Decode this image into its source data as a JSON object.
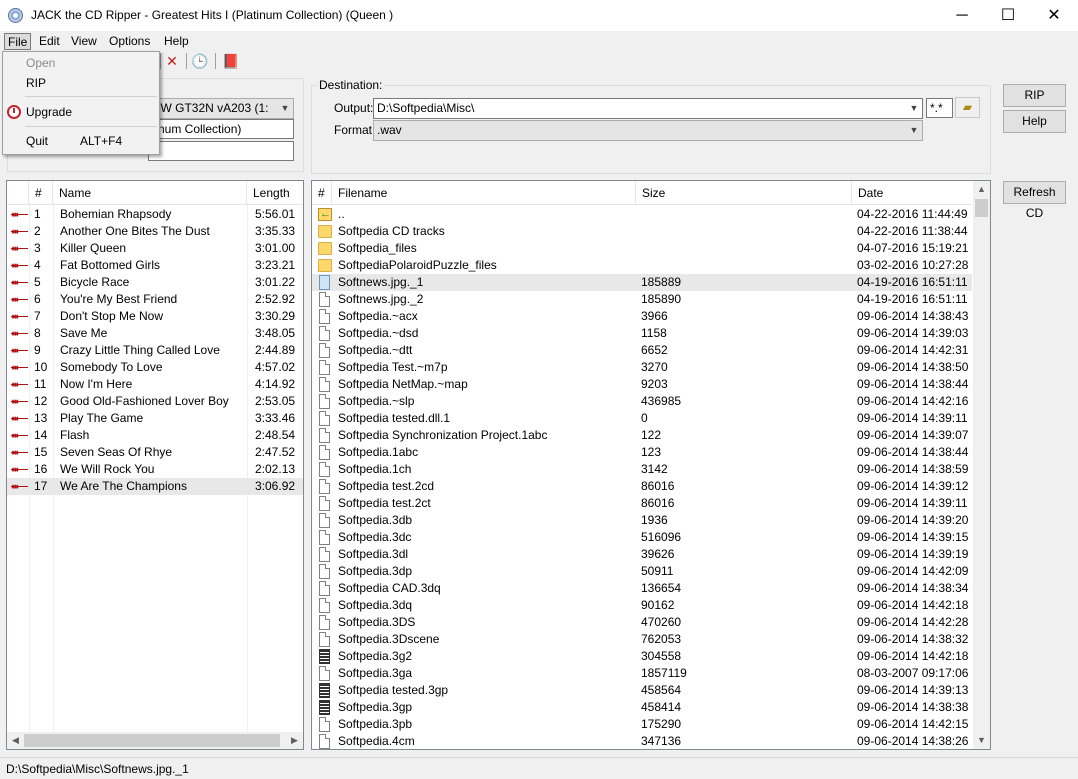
{
  "window": {
    "title": "JACK the CD Ripper - Greatest Hits I (Platinum  Collection) (Queen )",
    "minimize": "─",
    "maximize": "☐",
    "close": "✕"
  },
  "menubar": {
    "items": [
      {
        "label": "File",
        "underline": "F"
      },
      {
        "label": "Edit",
        "underline": "E"
      },
      {
        "label": "View",
        "underline": "V"
      },
      {
        "label": "Options",
        "underline": "O"
      },
      {
        "label": "Help",
        "underline": "H"
      }
    ]
  },
  "file_menu": {
    "open": "Open",
    "rip": "RIP",
    "upgrade": "Upgrade",
    "quit": "Quit",
    "quit_shortcut": "ALT+F4"
  },
  "toolbar": {
    "stop_icon": "✕",
    "timer_icon": "🕒",
    "book_icon": "📕"
  },
  "cd_panel": {
    "drive": "RW GT32N   vA203 (1:",
    "album": "tinum  Collection)",
    "artist": ""
  },
  "destination": {
    "group_label": "Destination:",
    "output_label": "Output:",
    "output_value": "D:\\Softpedia\\Misc\\",
    "mask_value": "*.*",
    "format_label": "Format:",
    "format_value": ".wav"
  },
  "buttons": {
    "rip": "RIP",
    "help": "Help",
    "refresh_cd": "Refresh CD"
  },
  "tracks": {
    "columns": [
      "#",
      "Name",
      "Length"
    ],
    "rows": [
      {
        "num": "1",
        "name": "Bohemian Rhapsody",
        "length": "5:56.01"
      },
      {
        "num": "2",
        "name": "Another One Bites The Dust",
        "length": "3:35.33"
      },
      {
        "num": "3",
        "name": "Killer Queen",
        "length": "3:01.00"
      },
      {
        "num": "4",
        "name": "Fat Bottomed Girls",
        "length": "3:23.21"
      },
      {
        "num": "5",
        "name": "Bicycle Race",
        "length": "3:01.22"
      },
      {
        "num": "6",
        "name": "You're My Best Friend",
        "length": "2:52.92"
      },
      {
        "num": "7",
        "name": "Don't Stop Me Now",
        "length": "3:30.29"
      },
      {
        "num": "8",
        "name": "Save Me",
        "length": "3:48.05"
      },
      {
        "num": "9",
        "name": "Crazy Little Thing Called Love",
        "length": "2:44.89"
      },
      {
        "num": "10",
        "name": "Somebody To Love",
        "length": "4:57.02"
      },
      {
        "num": "11",
        "name": "Now I'm Here",
        "length": "4:14.92"
      },
      {
        "num": "12",
        "name": "Good Old-Fashioned Lover Boy",
        "length": "2:53.05"
      },
      {
        "num": "13",
        "name": "Play The Game",
        "length": "3:33.46"
      },
      {
        "num": "14",
        "name": "Flash",
        "length": "2:48.54"
      },
      {
        "num": "15",
        "name": "Seven Seas Of Rhye",
        "length": "2:47.52"
      },
      {
        "num": "16",
        "name": "We Will Rock You",
        "length": "2:02.13"
      },
      {
        "num": "17",
        "name": "We Are The Champions",
        "length": "3:06.92"
      }
    ]
  },
  "files": {
    "columns": [
      "#",
      "Filename",
      "Size",
      "Date"
    ],
    "rows": [
      {
        "icon": "up",
        "name": "..",
        "size": "",
        "date": "04-22-2016 11:44:49"
      },
      {
        "icon": "folder",
        "name": "Softpedia CD tracks",
        "size": "",
        "date": "04-22-2016 11:38:44"
      },
      {
        "icon": "folder",
        "name": "Softpedia_files",
        "size": "",
        "date": "04-07-2016 15:19:21"
      },
      {
        "icon": "folder",
        "name": "SoftpediaPolaroidPuzzle_files",
        "size": "",
        "date": "03-02-2016 10:27:28"
      },
      {
        "icon": "image",
        "name": "Softnews.jpg._1",
        "size": "185889",
        "date": "04-19-2016 16:51:11"
      },
      {
        "icon": "file",
        "name": "Softnews.jpg._2",
        "size": "185890",
        "date": "04-19-2016 16:51:11"
      },
      {
        "icon": "file",
        "name": "Softpedia.~acx",
        "size": "3966",
        "date": "09-06-2014 14:38:43"
      },
      {
        "icon": "file",
        "name": "Softpedia.~dsd",
        "size": "1158",
        "date": "09-06-2014 14:39:03"
      },
      {
        "icon": "file",
        "name": "Softpedia.~dtt",
        "size": "6652",
        "date": "09-06-2014 14:42:31"
      },
      {
        "icon": "file",
        "name": "Softpedia Test.~m7p",
        "size": "3270",
        "date": "09-06-2014 14:38:50"
      },
      {
        "icon": "file",
        "name": "Softpedia NetMap.~map",
        "size": "9203",
        "date": "09-06-2014 14:38:44"
      },
      {
        "icon": "file",
        "name": "Softpedia.~slp",
        "size": "436985",
        "date": "09-06-2014 14:42:16"
      },
      {
        "icon": "file",
        "name": "Softpedia tested.dll.1",
        "size": "0",
        "date": "09-06-2014 14:39:11"
      },
      {
        "icon": "file",
        "name": "Softpedia Synchronization Project.1abc",
        "size": "122",
        "date": "09-06-2014 14:39:07"
      },
      {
        "icon": "file",
        "name": "Softpedia.1abc",
        "size": "123",
        "date": "09-06-2014 14:38:44"
      },
      {
        "icon": "file",
        "name": "Softpedia.1ch",
        "size": "3142",
        "date": "09-06-2014 14:38:59"
      },
      {
        "icon": "file",
        "name": "Softpedia test.2cd",
        "size": "86016",
        "date": "09-06-2014 14:39:12"
      },
      {
        "icon": "file",
        "name": "Softpedia test.2ct",
        "size": "86016",
        "date": "09-06-2014 14:39:11"
      },
      {
        "icon": "file",
        "name": "Softpedia.3db",
        "size": "1936",
        "date": "09-06-2014 14:39:20"
      },
      {
        "icon": "file",
        "name": "Softpedia.3dc",
        "size": "516096",
        "date": "09-06-2014 14:39:15"
      },
      {
        "icon": "file",
        "name": "Softpedia.3dl",
        "size": "39626",
        "date": "09-06-2014 14:39:19"
      },
      {
        "icon": "file",
        "name": "Softpedia.3dp",
        "size": "50911",
        "date": "09-06-2014 14:42:09"
      },
      {
        "icon": "file",
        "name": "Softpedia CAD.3dq",
        "size": "136654",
        "date": "09-06-2014 14:38:34"
      },
      {
        "icon": "file",
        "name": "Softpedia.3dq",
        "size": "90162",
        "date": "09-06-2014 14:42:18"
      },
      {
        "icon": "file",
        "name": "Softpedia.3DS",
        "size": "470260",
        "date": "09-06-2014 14:42:28"
      },
      {
        "icon": "file",
        "name": "Softpedia.3Dscene",
        "size": "762053",
        "date": "09-06-2014 14:38:32"
      },
      {
        "icon": "video",
        "name": "Softpedia.3g2",
        "size": "304558",
        "date": "09-06-2014 14:42:18"
      },
      {
        "icon": "file",
        "name": "Softpedia.3ga",
        "size": "1857119",
        "date": "08-03-2007 09:17:06"
      },
      {
        "icon": "video",
        "name": "Softpedia tested.3gp",
        "size": "458564",
        "date": "09-06-2014 14:39:13"
      },
      {
        "icon": "video",
        "name": "Softpedia.3gp",
        "size": "458414",
        "date": "09-06-2014 14:38:38"
      },
      {
        "icon": "file",
        "name": "Softpedia.3pb",
        "size": "175290",
        "date": "09-06-2014 14:42:15"
      },
      {
        "icon": "file",
        "name": "Softpedia.4cm",
        "size": "347136",
        "date": "09-06-2014 14:38:26"
      }
    ]
  },
  "statusbar": {
    "text": "D:\\Softpedia\\Misc\\Softnews.jpg._1"
  }
}
